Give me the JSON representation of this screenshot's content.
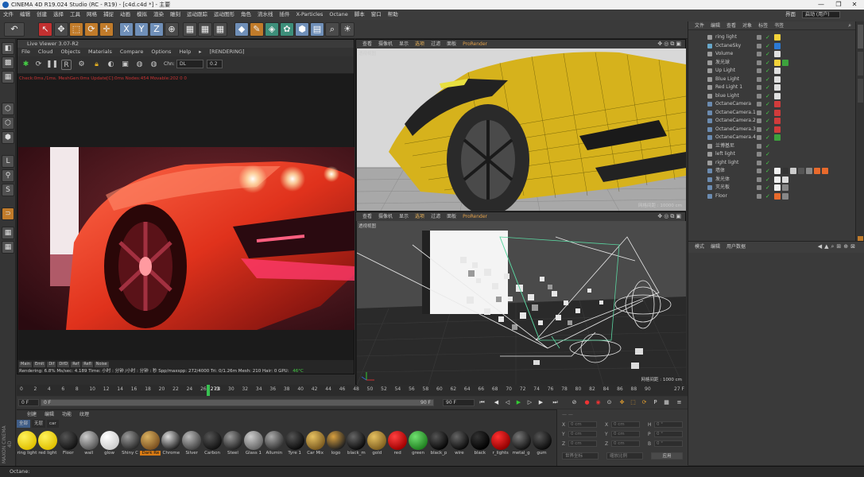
{
  "window": {
    "title": "CINEMA 4D R19.024 Studio (RC - R19) - [c4d.c4d *] - 主要",
    "controls": [
      "—",
      "❐",
      "✕"
    ]
  },
  "menubar": {
    "items": [
      "文件",
      "编辑",
      "创建",
      "选择",
      "工具",
      "网格",
      "捕捉",
      "动画",
      "模拟",
      "渲染",
      "雕刻",
      "运动跟踪",
      "运动图形",
      "角色",
      "流水线",
      "插件",
      "X-Particles",
      "Octane",
      "脚本",
      "窗口",
      "帮助"
    ],
    "layout_label": "界面",
    "layout_value": "启动 (用户)"
  },
  "live_viewer": {
    "title": "Live Viewer 3.07-R2",
    "menu": [
      "File",
      "Cloud",
      "Objects",
      "Materials",
      "Compare",
      "Options",
      "Help",
      "▸",
      "[RENDERING]"
    ],
    "chn_label": "Chn:",
    "chn_value": "DL",
    "zoom_value": "0.2",
    "stats": "Check:0ms./1ms. MeshGen:0ms Update[C]:0ms Nodes:454 Movable:202 0 0",
    "chips": [
      "Main",
      "Emit",
      "Dif",
      "DifD",
      "Ref",
      "Refl",
      "Noise"
    ],
    "render_line": "Rendering: 6.8%   Ms/sec: 4.189   Time: 小时 : 分钟 /小时 : 分钟 : 秒   Spp/maxspp: 272/4000   Tri: 0/1.26m   Mesh: 210  Hair: 0    GPU:",
    "gpu_temp": "46°C"
  },
  "viewport_top": {
    "menu": [
      "查看",
      "摄像机",
      "显示",
      "选项",
      "过滤",
      "面板"
    ],
    "active_index": 3,
    "render_label": "ProRender",
    "view_label": "透视视图",
    "grid": "网格间距 : 10000 cm"
  },
  "viewport_bottom": {
    "menu": [
      "查看",
      "摄像机",
      "显示",
      "选项",
      "过滤",
      "面板"
    ],
    "active_index": 3,
    "render_label": "ProRender",
    "view_label": "透视视图",
    "grid": "网格间距 : 1000 cm"
  },
  "object_manager": {
    "menu": [
      "文件",
      "编辑",
      "查看",
      "对象",
      "标签",
      "书签"
    ],
    "objects": [
      {
        "name": "ring light",
        "color": "#9c9c9c",
        "tags": [
          "#f3d23a"
        ]
      },
      {
        "name": "OctaneSky",
        "color": "#68a7c9",
        "tags": [
          "#2c7ad6"
        ]
      },
      {
        "name": "Volume",
        "color": "#9c9c9c",
        "tags": [
          "#e0e0e0"
        ]
      },
      {
        "name": "发光球",
        "color": "#9c9c9c",
        "tags": [
          "#f3d23a",
          "#3da23d"
        ]
      },
      {
        "name": "Up Light",
        "color": "#9c9c9c",
        "tags": [
          "#e0e0e0"
        ]
      },
      {
        "name": "Blue Light",
        "color": "#9c9c9c",
        "tags": [
          "#e0e0e0"
        ]
      },
      {
        "name": "Red Light 1",
        "color": "#9c9c9c",
        "tags": [
          "#e0e0e0"
        ]
      },
      {
        "name": "blue Light",
        "color": "#9c9c9c",
        "tags": [
          "#e0e0e0"
        ]
      },
      {
        "name": "OctaneCamera",
        "color": "#6b8bb0",
        "tags": [
          "#d13b3b"
        ]
      },
      {
        "name": "OctaneCamera.1",
        "color": "#6b8bb0",
        "tags": [
          "#d13b3b"
        ]
      },
      {
        "name": "OctaneCamera.2",
        "color": "#6b8bb0",
        "tags": [
          "#d13b3b"
        ]
      },
      {
        "name": "OctaneCamera.3",
        "color": "#6b8bb0",
        "tags": [
          "#d13b3b"
        ]
      },
      {
        "name": "OctaneCamera.4",
        "color": "#6b8bb0",
        "tags": [
          "#3da23d"
        ]
      },
      {
        "name": "兰博基尼",
        "color": "#9c9c9c",
        "tags": []
      },
      {
        "name": "left light",
        "color": "#9c9c9c",
        "tags": []
      },
      {
        "name": "right light",
        "color": "#9c9c9c",
        "tags": []
      },
      {
        "name": "墙体",
        "color": "#6b8bb0",
        "tags": [
          "#f0f0f0",
          "#333333",
          "#cccccc",
          "#555555",
          "#888888",
          "#e86a2c",
          "#e86a2c"
        ]
      },
      {
        "name": "发光体",
        "color": "#6b8bb0",
        "tags": [
          "#f0f0f0",
          "#dddddd"
        ]
      },
      {
        "name": "灭光板",
        "color": "#6b8bb0",
        "tags": [
          "#f0f0f0",
          "#888888"
        ]
      },
      {
        "name": "Floor",
        "color": "#6b8bb0",
        "tags": [
          "#e86a2c",
          "#888888"
        ]
      }
    ]
  },
  "attributes": {
    "menu": [
      "模式",
      "编辑",
      "用户数据"
    ]
  },
  "timeline": {
    "ticks": [
      0,
      2,
      4,
      6,
      8,
      10,
      12,
      14,
      16,
      18,
      20,
      22,
      24,
      26,
      28,
      30,
      32,
      34,
      36,
      38,
      40,
      42,
      44,
      46,
      48,
      50,
      52,
      54,
      56,
      58,
      60,
      62,
      64,
      66,
      68,
      70,
      72,
      74,
      76,
      78,
      80,
      82,
      84,
      86,
      88,
      90
    ],
    "current_frame": 27,
    "current_frame_label": "273",
    "end_label": "27 F",
    "start_field": "0 F",
    "range_start": "0 F",
    "range_end": "90 F",
    "end_field": "90 F"
  },
  "materials": {
    "menu": [
      "创建",
      "编辑",
      "功能",
      "纹理"
    ],
    "filters": [
      "全部",
      "无层",
      "car"
    ],
    "active_filter": 0,
    "items": [
      {
        "name": "ring light",
        "c1": "#fff25a",
        "c2": "#e0c000"
      },
      {
        "name": "red light",
        "c1": "#fff25a",
        "c2": "#e0c000"
      },
      {
        "name": "Floor",
        "c1": "#555555",
        "c2": "#111111"
      },
      {
        "name": "wall",
        "c1": "#cccccc",
        "c2": "#555555"
      },
      {
        "name": "glow",
        "c1": "#ffffff",
        "c2": "#cccccc"
      },
      {
        "name": "Shiny C",
        "c1": "#9a9a9a",
        "c2": "#2a2a2a"
      },
      {
        "name": "Dark Re",
        "c1": "#d8b060",
        "c2": "#7a5020",
        "selected": true
      },
      {
        "name": "Chrome",
        "c1": "#dddddd",
        "c2": "#222222"
      },
      {
        "name": "Silver",
        "c1": "#bbbbbb",
        "c2": "#444444"
      },
      {
        "name": "Carbon",
        "c1": "#555555",
        "c2": "#111111"
      },
      {
        "name": "Steel",
        "c1": "#999999",
        "c2": "#222222"
      },
      {
        "name": "Glass 1",
        "c1": "#cccccc",
        "c2": "#666666"
      },
      {
        "name": "Allumin",
        "c1": "#aaaaaa",
        "c2": "#333333"
      },
      {
        "name": "Tyre 1",
        "c1": "#555555",
        "c2": "#0a0a0a"
      },
      {
        "name": "Car Mix",
        "c1": "#e6c060",
        "c2": "#7a5a20"
      },
      {
        "name": "logo",
        "c1": "#d8a040",
        "c2": "#202020"
      },
      {
        "name": "black_m",
        "c1": "#666666",
        "c2": "#0a0a0a"
      },
      {
        "name": "gold",
        "c1": "#e5c060",
        "c2": "#806020"
      },
      {
        "name": "red",
        "c1": "#ff4040",
        "c2": "#a00000"
      },
      {
        "name": "green",
        "c1": "#70e070",
        "c2": "#208020"
      },
      {
        "name": "black_p",
        "c1": "#555555",
        "c2": "#050505"
      },
      {
        "name": "wire",
        "c1": "#666666",
        "c2": "#0a0a0a"
      },
      {
        "name": "black",
        "c1": "#333333",
        "c2": "#000000"
      },
      {
        "name": "r_lights",
        "c1": "#ff3030",
        "c2": "#900000"
      },
      {
        "name": "metal_g",
        "c1": "#777777",
        "c2": "#111111"
      },
      {
        "name": "gum",
        "c1": "#555555",
        "c2": "#0a0a0a"
      }
    ]
  },
  "coords": {
    "rows": [
      {
        "a": "X",
        "av": "0 cm",
        "b": "X",
        "bv": "0 cm",
        "c": "H",
        "cv": "0 °"
      },
      {
        "a": "Y",
        "av": "0 cm",
        "b": "Y",
        "bv": "0 cm",
        "c": "P",
        "cv": "0 °"
      },
      {
        "a": "Z",
        "av": "0 cm",
        "b": "Z",
        "bv": "0 cm",
        "c": "B",
        "cv": "0 °"
      }
    ],
    "mode1": "世界坐标",
    "mode2": "缩放比例",
    "apply": "应用"
  },
  "status": {
    "text": "Octane:"
  },
  "branding": {
    "logo_text": "MAXON CINEMA 4D"
  }
}
